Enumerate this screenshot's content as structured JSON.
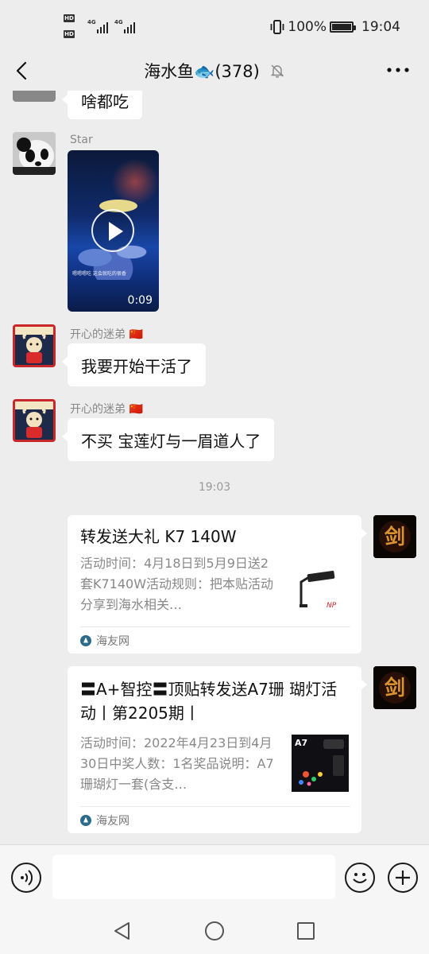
{
  "status_bar": {
    "hd1": "HD",
    "hd2": "HD",
    "net1": "4G",
    "net2": "4G",
    "battery": "100%",
    "time": "19:04"
  },
  "header": {
    "back_icon": "chevron-left-icon",
    "title": "海水鱼🐟(378)",
    "mute_icon": "muted-bell-icon",
    "more_icon": "more-dots-icon"
  },
  "messages": {
    "partial": {
      "text": "啥都吃"
    },
    "video_msg": {
      "sender": "Star",
      "caption": "嗯嗯嗯吃 这会就吃的很香",
      "duration": "0:09"
    },
    "msg1": {
      "sender": "开心的迷弟 🇨🇳",
      "text": "我要开始干活了"
    },
    "msg2": {
      "sender": "开心的迷弟 🇨🇳",
      "text": "不买 宝莲灯与一眉道人了"
    },
    "time_separator": "19:03",
    "card1": {
      "title": "转发送大礼 K7 140W",
      "desc": "活动时间：4月18日到5月9日送2套K7140W活动规则：把本贴活动分享到海水相关…",
      "source": "海友网",
      "thumb_label": "NP"
    },
    "card2": {
      "title": "〓A+智控〓顶贴转发送A7珊 瑚灯活动丨第2205期丨",
      "desc": "活动时间：2022年4月23日到4月30日中奖人数：1名奖品说明：A7珊瑚灯一套(含支…",
      "source": "海友网",
      "thumb_label": "A7"
    }
  },
  "input_bar": {
    "voice_icon": "voice-icon",
    "input_value": "",
    "emoji_icon": "emoji-icon",
    "plus_icon": "plus-icon"
  },
  "nav_bar": {
    "back": "nav-back-icon",
    "home": "nav-home-icon",
    "recent": "nav-recent-icon"
  }
}
